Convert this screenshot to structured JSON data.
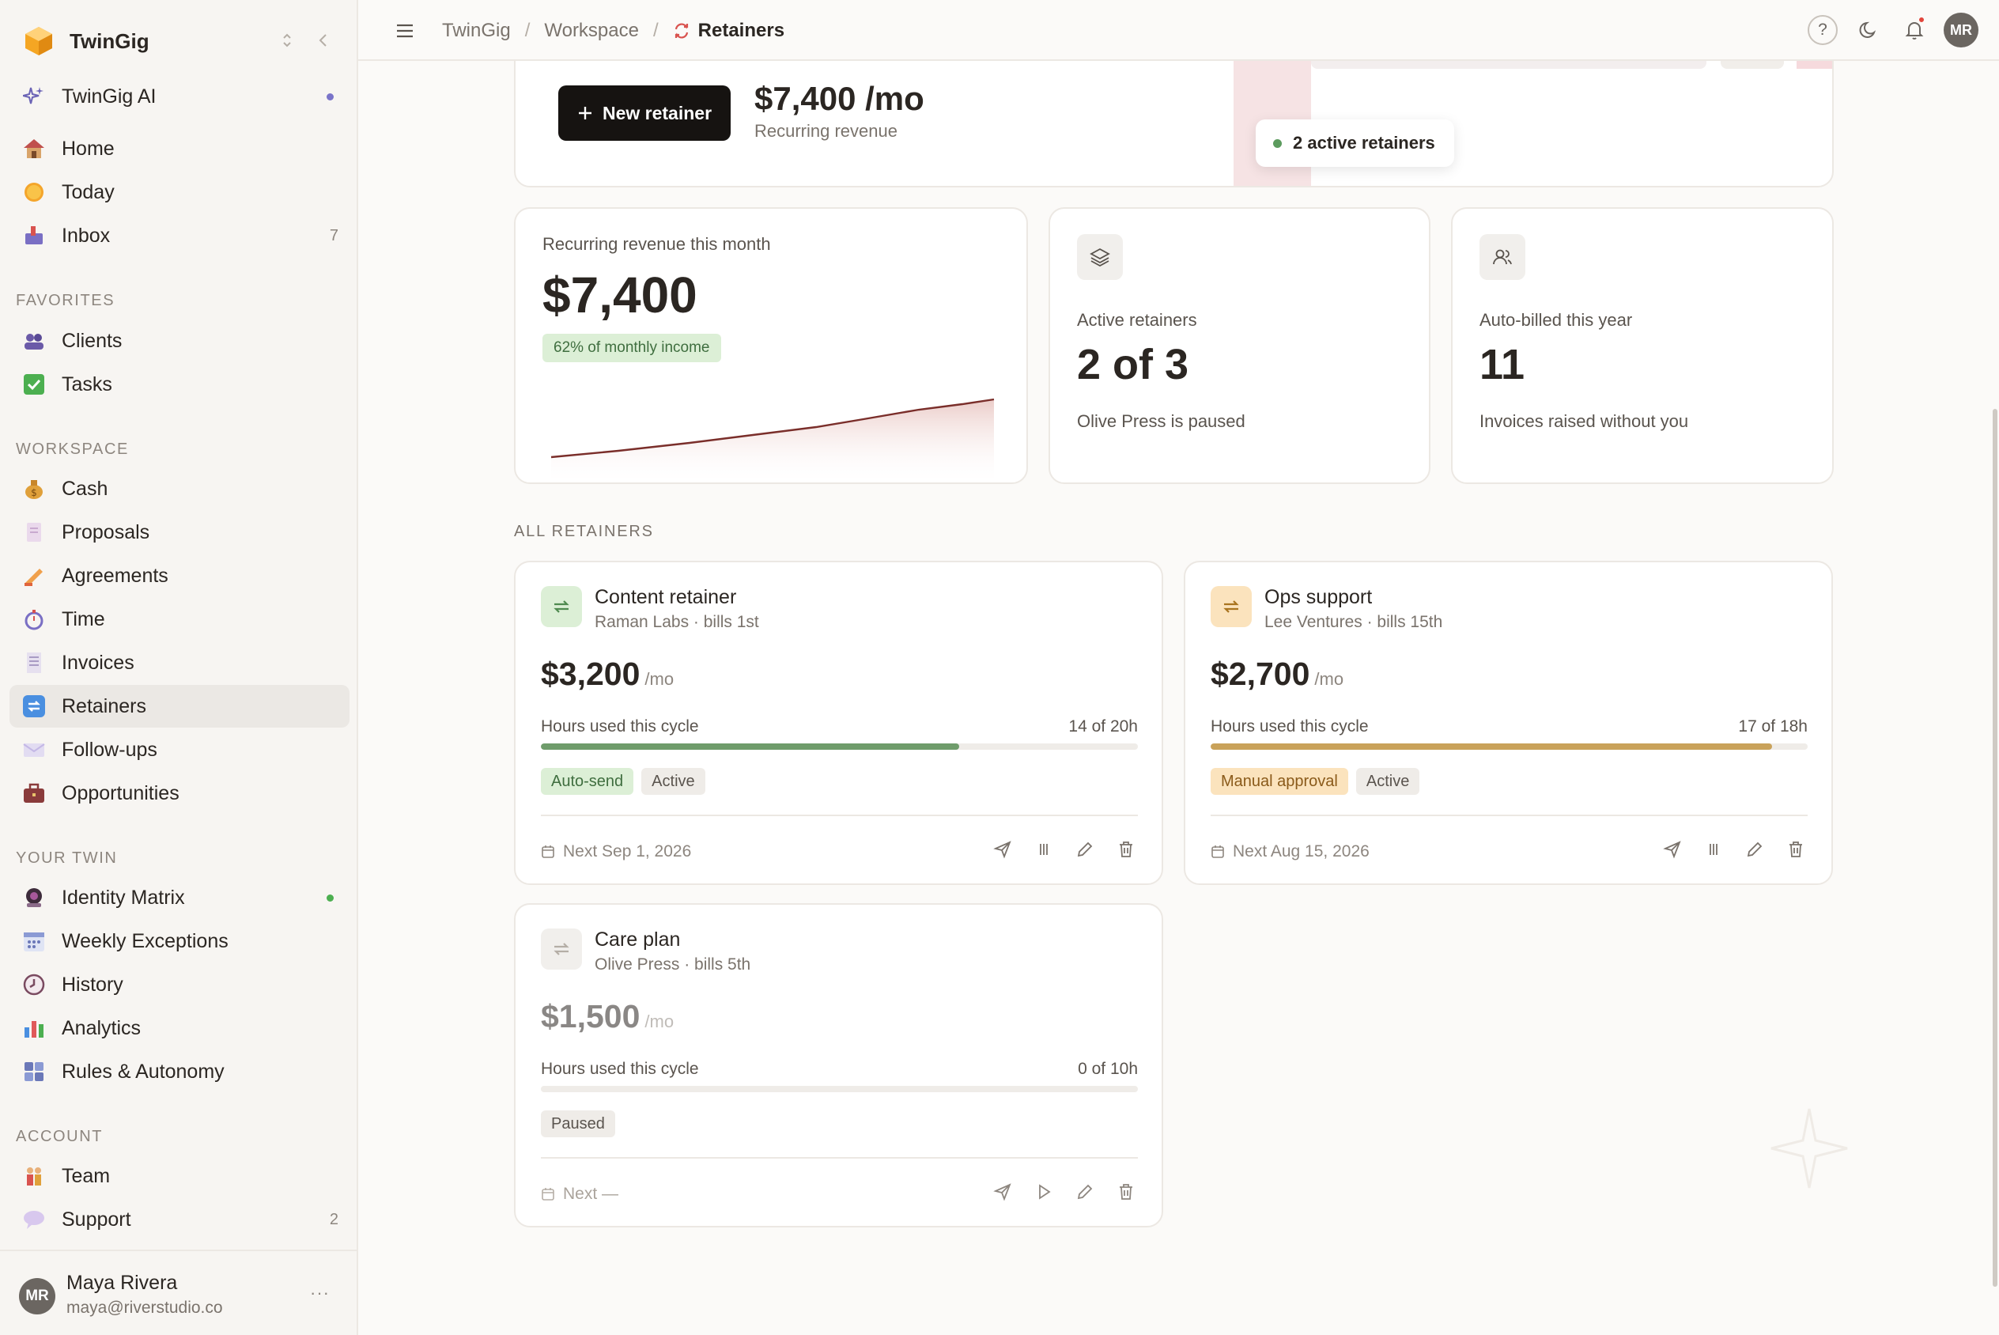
{
  "app": {
    "name": "TwinGig"
  },
  "sidebar": {
    "ai_item": {
      "label": "TwinGig AI",
      "icon": "sparkle-icon"
    },
    "top_items": [
      {
        "label": "Home",
        "icon": "house-icon",
        "count": ""
      },
      {
        "label": "Today",
        "icon": "sun-icon",
        "count": ""
      },
      {
        "label": "Inbox",
        "icon": "inbox-icon",
        "count": "7"
      }
    ],
    "favorites_title": "FAVORITES",
    "favorites": [
      {
        "label": "Clients",
        "icon": "people-icon"
      },
      {
        "label": "Tasks",
        "icon": "checkbox-icon"
      }
    ],
    "workspace_title": "WORKSPACE",
    "workspace": [
      {
        "label": "Cash",
        "icon": "money-bag-icon"
      },
      {
        "label": "Proposals",
        "icon": "document-icon"
      },
      {
        "label": "Agreements",
        "icon": "signature-icon"
      },
      {
        "label": "Time",
        "icon": "stopwatch-icon"
      },
      {
        "label": "Invoices",
        "icon": "receipt-icon"
      },
      {
        "label": "Retainers",
        "icon": "repeat-icon"
      },
      {
        "label": "Follow-ups",
        "icon": "envelope-icon"
      },
      {
        "label": "Opportunities",
        "icon": "briefcase-icon"
      }
    ],
    "twin_title": "YOUR TWIN",
    "twin": [
      {
        "label": "Identity Matrix",
        "icon": "identity-icon"
      },
      {
        "label": "Weekly Exceptions",
        "icon": "calendar-icon"
      },
      {
        "label": "History",
        "icon": "clock-icon"
      },
      {
        "label": "Analytics",
        "icon": "bar-chart-icon"
      },
      {
        "label": "Rules & Autonomy",
        "icon": "grid-icon"
      }
    ],
    "account_title": "ACCOUNT",
    "account": [
      {
        "label": "Team",
        "icon": "team-icon",
        "count": ""
      },
      {
        "label": "Support",
        "icon": "speech-bubble-icon",
        "count": "2"
      }
    ],
    "user": {
      "initials": "MR",
      "name": "Maya Rivera",
      "email": "maya@riverstudio.co",
      "more": "···"
    }
  },
  "topbar": {
    "breadcrumbs": [
      "TwinGig",
      "Workspace",
      "Retainers"
    ],
    "help": "?",
    "avatar": "MR"
  },
  "hero": {
    "new_button": "New retainer",
    "amount": "$7,400 /mo",
    "sub": "Recurring revenue",
    "pill": "2 active retainers"
  },
  "stats": [
    {
      "label": "Recurring revenue this month",
      "value": "$7,400",
      "chip": "62% of monthly income"
    },
    {
      "label": "Active retainers",
      "value": "2 of 3",
      "foot": "Olive Press is paused",
      "icon": "layers-icon"
    },
    {
      "label": "Auto-billed this year",
      "value": "11",
      "foot": "Invoices raised without you",
      "icon": "users-icon"
    }
  ],
  "all_title": "ALL RETAINERS",
  "retainers": [
    {
      "title": "Content retainer",
      "sub": "Raman Labs · bills 1st",
      "amount": "$3,200",
      "per": "/mo",
      "hours_label": "Hours used this cycle",
      "hours": "14 of 20h",
      "fill": 0.7,
      "tags": [
        "Auto-send",
        "Active"
      ],
      "next": "Next Sep 1, 2026",
      "color": "#6f9c6b"
    },
    {
      "title": "Ops support",
      "sub": "Lee Ventures · bills 15th",
      "amount": "$2,700",
      "per": "/mo",
      "hours_label": "Hours used this cycle",
      "hours": "17 of 18h",
      "fill": 0.94,
      "tags": [
        "Manual approval",
        "Active"
      ],
      "next": "Next Aug 15, 2026",
      "color": "#c9a25a"
    },
    {
      "title": "Care plan",
      "sub": "Olive Press · bills 5th",
      "amount": "$1,500",
      "per": "/mo",
      "hours_label": "Hours used this cycle",
      "hours": "0 of 10h",
      "fill": 0,
      "tags": [
        "Paused"
      ],
      "next": "Next —",
      "color": "#b5aea6"
    }
  ]
}
